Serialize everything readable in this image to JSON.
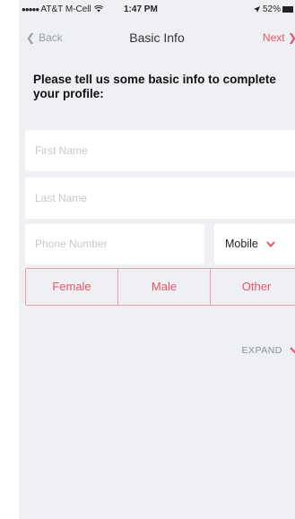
{
  "status_bar": {
    "carrier": "AT&T M-Cell",
    "signal_dots": "●●●●●",
    "time": "1:47 PM",
    "battery": "52%"
  },
  "nav": {
    "back_label": "Back",
    "title": "Basic Info",
    "next_label": "Next"
  },
  "intro_text": "Please tell us some basic info to complete your profile:",
  "form": {
    "first_name_placeholder": "First Name",
    "last_name_placeholder": "Last Name",
    "phone_placeholder": "Phone Number",
    "phone_type": "Mobile"
  },
  "gender": {
    "options": [
      "Female",
      "Male",
      "Other"
    ]
  },
  "expand_label": "EXPAND",
  "colors": {
    "accent": "#e8546a",
    "background": "#eef0f3"
  }
}
